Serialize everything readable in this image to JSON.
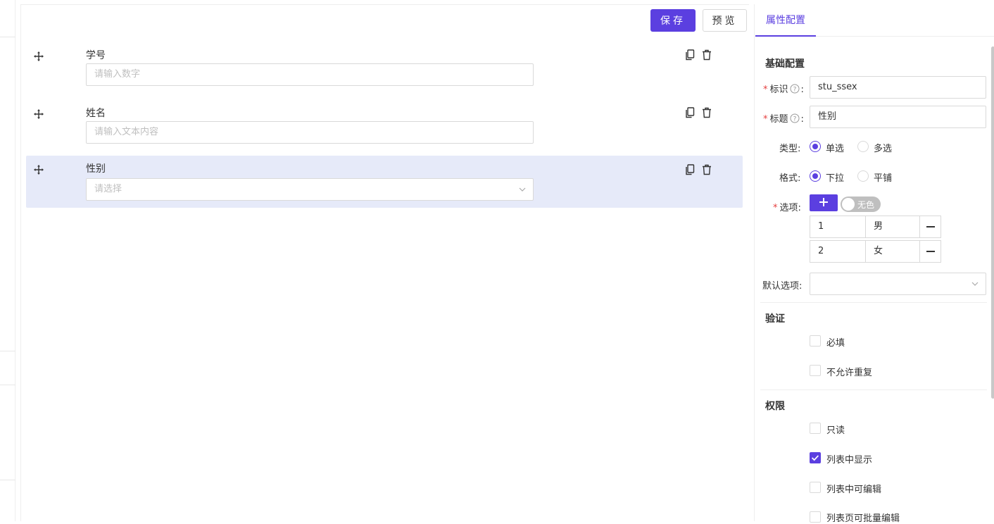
{
  "toolbar": {
    "save_label": "保存",
    "preview_label": "预览"
  },
  "fields": [
    {
      "label": "学号",
      "placeholder": "请输入数字"
    },
    {
      "label": "姓名",
      "placeholder": "请输入文本内容"
    },
    {
      "label": "性别",
      "placeholder": "请选择"
    }
  ],
  "panel": {
    "tab": "属性配置",
    "basic": {
      "title": "基础配置",
      "id_label": "标识",
      "id_value": "stu_ssex",
      "title_label": "标题",
      "title_value": "性别",
      "type_label": "类型:",
      "type_options": [
        "单选",
        "多选"
      ],
      "type_selected": "单选",
      "format_label": "格式:",
      "format_options": [
        "下拉",
        "平铺"
      ],
      "format_selected": "下拉",
      "options_label": "选项:",
      "color_toggle": "无色",
      "options": [
        {
          "value": "1",
          "text": "男"
        },
        {
          "value": "2",
          "text": "女"
        }
      ],
      "default_label": "默认选项:"
    },
    "validation": {
      "title": "验证",
      "items": [
        {
          "label": "必填",
          "checked": false
        },
        {
          "label": "不允许重复",
          "checked": false
        }
      ]
    },
    "permission": {
      "title": "权限",
      "items": [
        {
          "label": "只读",
          "checked": false
        },
        {
          "label": "列表中显示",
          "checked": true
        },
        {
          "label": "列表中可编辑",
          "checked": false
        },
        {
          "label": "列表页可批量编辑",
          "checked": false
        }
      ]
    }
  },
  "colors": {
    "accent": "#5b3fe0",
    "selected_bg": "#e6eaf9",
    "required": "#e53e3e"
  }
}
